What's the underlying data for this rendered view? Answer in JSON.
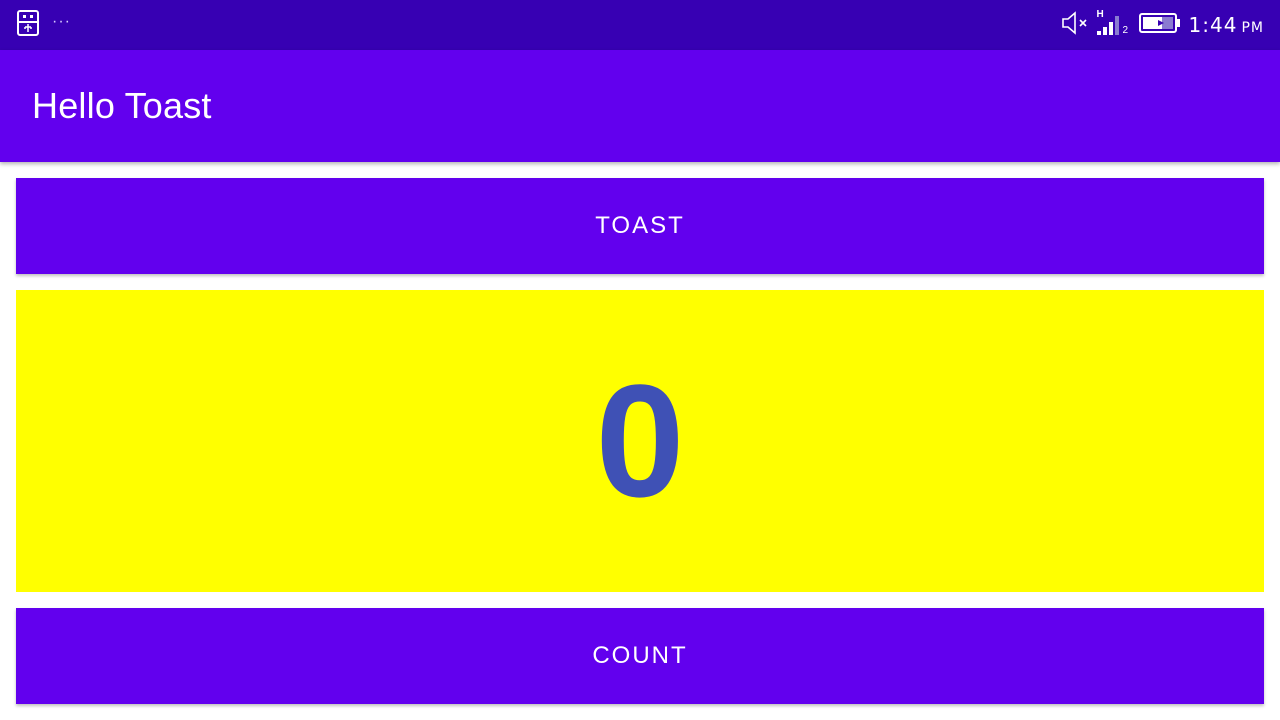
{
  "status_bar": {
    "background": "#3700b3",
    "left_icons": [
      "usb-icon",
      "more-notifications-icon"
    ],
    "overflow_text": "···",
    "right_icons": [
      "mute-icon",
      "signal-icon",
      "battery-icon"
    ],
    "network_type": "H",
    "sim_slot": "2",
    "time": "1:44",
    "ampm": "PM"
  },
  "app_bar": {
    "title": "Hello Toast",
    "background": "#6200ee"
  },
  "buttons": {
    "toast_label": "TOAST",
    "count_label": "COUNT",
    "background": "#6200ee"
  },
  "counter": {
    "value": "0",
    "text_color": "#3f51b5",
    "background": "#ffff00"
  }
}
